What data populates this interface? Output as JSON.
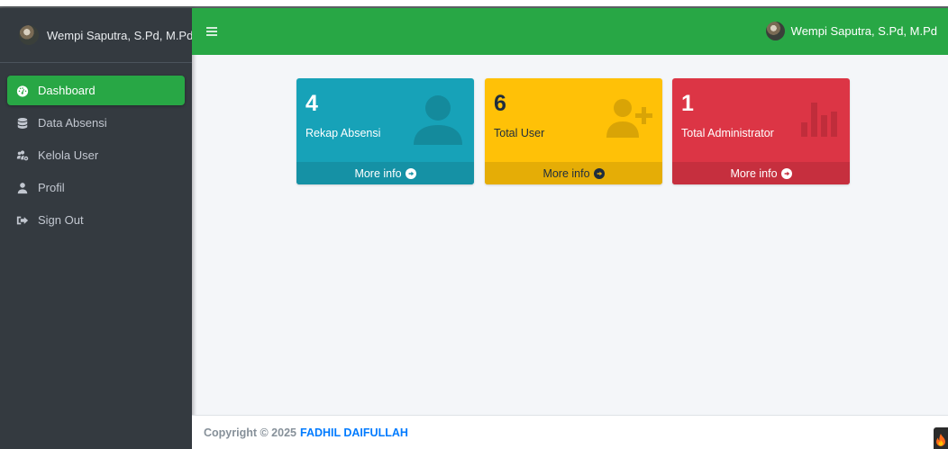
{
  "brand": {
    "user_name": "Wempi Saputra, S.Pd, M.Pd"
  },
  "sidebar": {
    "items": [
      {
        "label": "Dashboard",
        "icon": "tachometer-icon",
        "active": true
      },
      {
        "label": "Data Absensi",
        "icon": "database-icon",
        "active": false
      },
      {
        "label": "Kelola User",
        "icon": "users-cog-icon",
        "active": false
      },
      {
        "label": "Profil",
        "icon": "user-icon",
        "active": false
      },
      {
        "label": "Sign Out",
        "icon": "sign-out-icon",
        "active": false
      }
    ]
  },
  "navbar": {
    "user_name": "Wempi Saputra, S.Pd, M.Pd"
  },
  "cards": [
    {
      "value": "4",
      "label": "Rekap Absensi",
      "link": "More info",
      "icon": "user-icon",
      "color": "#17a2b8"
    },
    {
      "value": "6",
      "label": "Total User",
      "link": "More info",
      "icon": "user-plus-icon",
      "color": "#ffc107"
    },
    {
      "value": "1",
      "label": "Total Administrator",
      "link": "More info",
      "icon": "chart-bar-icon",
      "color": "#dc3545"
    }
  ],
  "footer": {
    "copyright": "Copyright © 2025",
    "author": "FADHIL DAIFULLAH"
  },
  "colors": {
    "accent": "#28a745",
    "sidebar": "#343a40",
    "info": "#17a2b8",
    "warning": "#ffc107",
    "danger": "#dc3545"
  }
}
